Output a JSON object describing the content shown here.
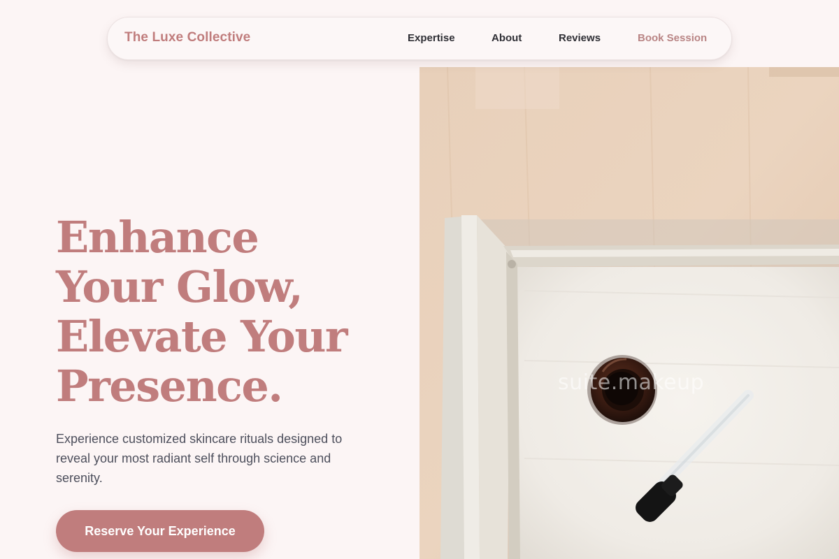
{
  "brand": {
    "name": "The Luxe Collective"
  },
  "nav": {
    "links": [
      "Expertise",
      "About",
      "Reviews"
    ],
    "cta_label": "Book Session"
  },
  "hero": {
    "headline_lines": [
      "Enhance",
      "Your Glow,",
      "Elevate Your",
      "Presence."
    ],
    "subtext": "Experience customized skincare rituals designed to reveal your most radiant self through science and serenity.",
    "button_label": "Reserve Your Experience",
    "image_watermark": "suite.makeup"
  },
  "colors": {
    "accent": "#c07d7d",
    "background": "#fcf5f5",
    "text_dark": "#2f2f35",
    "text_body": "#4d4f5c"
  }
}
